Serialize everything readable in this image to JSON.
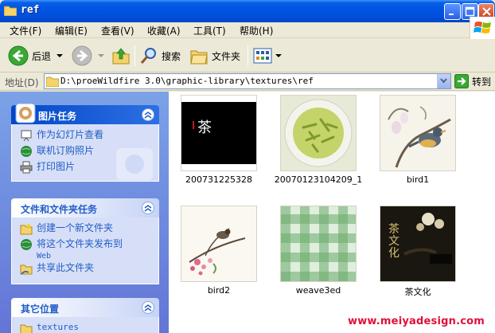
{
  "window": {
    "title": "ref"
  },
  "menu": [
    "文件(F)",
    "编辑(E)",
    "查看(V)",
    "收藏(A)",
    "工具(T)",
    "帮助(H)"
  ],
  "toolbar": {
    "back": "后退",
    "search": "搜索",
    "folders": "文件夹"
  },
  "address": {
    "label": "地址(D)",
    "value": "D:\\proeWildfire 3.0\\graphic-library\\textures\\ref",
    "go": "转到"
  },
  "tasks": {
    "picture": {
      "title": "图片任务",
      "items": [
        "作为幻灯片查看",
        "联机订购照片",
        "打印图片"
      ]
    },
    "files": {
      "title": "文件和文件夹任务",
      "items": [
        "创建一个新文件夹",
        "将这个文件夹发布到",
        "Web",
        "共享此文件夹"
      ]
    },
    "other": {
      "title": "其它位置",
      "items": [
        "textures"
      ]
    }
  },
  "thumbnails": [
    {
      "name": "200731225328",
      "thumb_text": "茶"
    },
    {
      "name": "20070123104209_1"
    },
    {
      "name": "bird1"
    },
    {
      "name": "bird2"
    },
    {
      "name": "weave3ed"
    },
    {
      "name": "茶文化",
      "thumb_text": "茶文化"
    }
  ],
  "watermark": "www.meiyadesign.com",
  "colors": {
    "titlebar": "#0054e3",
    "task_pane": "#7ba2e7",
    "link": "#215dc6",
    "watermark": "#e0103a"
  }
}
